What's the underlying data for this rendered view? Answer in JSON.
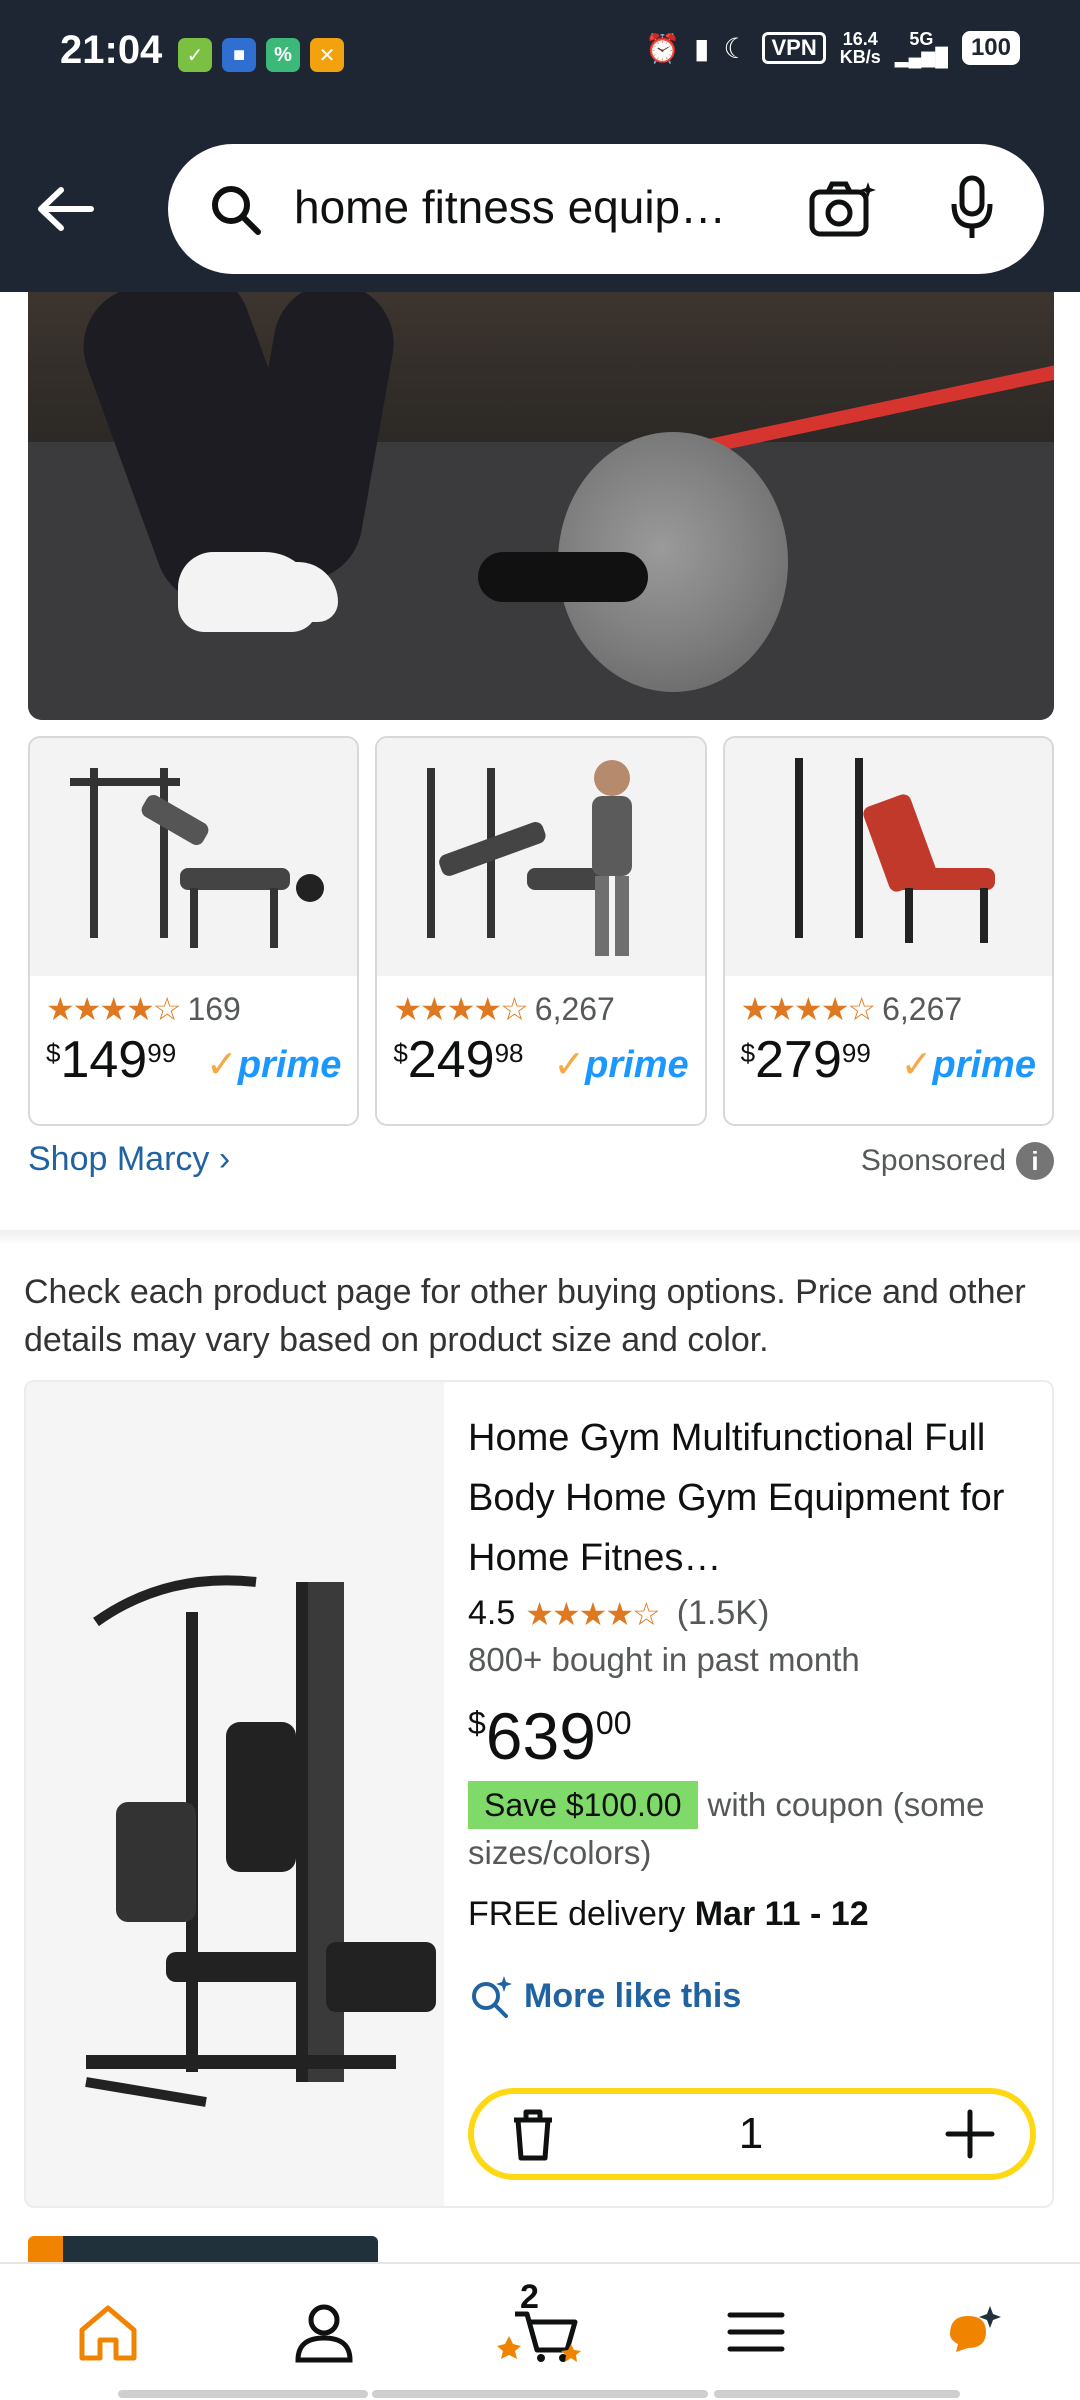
{
  "status_bar": {
    "time": "21:04",
    "vpn": "VPN",
    "net_speed_value": "16.4",
    "net_speed_unit": "KB/s",
    "network": "5G",
    "battery": "100"
  },
  "search": {
    "query": "home fitness equip…"
  },
  "carousel": {
    "products": [
      {
        "rating_count": "169",
        "currency": "$",
        "price_whole": "149",
        "price_fraction": "99",
        "badge": "prime"
      },
      {
        "rating_count": "6,267",
        "currency": "$",
        "price_whole": "249",
        "price_fraction": "98",
        "badge": "prime"
      },
      {
        "rating_count": "6,267",
        "currency": "$",
        "price_whole": "279",
        "price_fraction": "99",
        "badge": "prime"
      }
    ],
    "stars_glyph": "★★★★☆",
    "shop_link": "Shop Marcy ›",
    "sponsored": "Sponsored",
    "info_glyph": "i"
  },
  "notice": "Check each product page for other buying options. Price and other details may vary based on product size and color.",
  "result": {
    "title": "Home Gym Multifunctional Full Body Home Gym Equipment for Home Fitnes…",
    "rating": "4.5",
    "stars_glyph": "★★★★☆",
    "rating_count": "(1.5K)",
    "bought": "800+ bought in past month",
    "currency": "$",
    "price_whole": "639",
    "price_fraction": "00",
    "save_badge": "Save $100.00",
    "coupon_text": "with coupon (some sizes/colors)",
    "delivery_prefix": "FREE delivery ",
    "delivery_date": "Mar 11 - 12",
    "more_like": "More like this",
    "quantity": "1"
  },
  "bottom_nav": {
    "cart_count": "2"
  },
  "colors": {
    "header_bg": "#1d2632",
    "link": "#2162a1",
    "star": "#de7921",
    "prime": "#1a98ff",
    "save_badge": "#7fda69",
    "stepper_border": "#ffd814"
  }
}
